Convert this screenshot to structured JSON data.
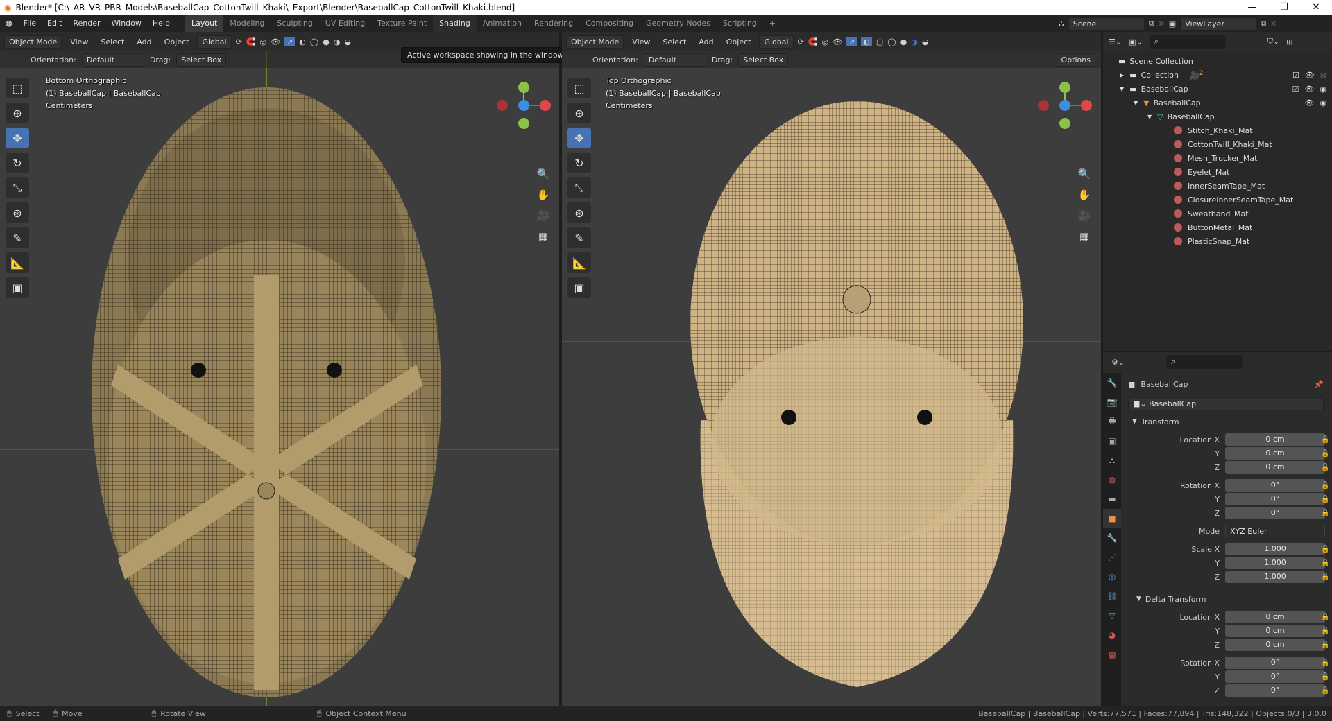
{
  "title": "Blender* [C:\\_AR_VR_PBR_Models\\BaseballCap_CottonTwill_Khaki\\_Export\\Blender\\BaseballCap_CottonTwill_Khaki.blend]",
  "menu": [
    "File",
    "Edit",
    "Render",
    "Window",
    "Help"
  ],
  "workspaces": [
    "Layout",
    "Modeling",
    "Sculpting",
    "UV Editing",
    "Texture Paint",
    "Shading",
    "Animation",
    "Rendering",
    "Compositing",
    "Geometry Nodes",
    "Scripting"
  ],
  "scene": "Scene",
  "view_layer": "ViewLayer",
  "tooltip": "Active workspace showing in the window.",
  "viewport_header": {
    "mode": "Object Mode",
    "view": "View",
    "select": "Select",
    "add": "Add",
    "object": "Object",
    "transform": "Global",
    "orientation_label": "Orientation:",
    "orientation": "Default",
    "drag_label": "Drag:",
    "drag": "Select Box",
    "options": "Options"
  },
  "left_view": {
    "name": "Bottom Orthographic",
    "object": "(1) BaseballCap | BaseballCap",
    "units": "Centimeters"
  },
  "right_view": {
    "name": "Top Orthographic",
    "object": "(1) BaseballCap | BaseballCap",
    "units": "Centimeters"
  },
  "outliner": {
    "root": "Scene Collection",
    "collection": "Collection",
    "collection_badge": "2",
    "cap_collection": "BaseballCap",
    "object": "BaseballCap",
    "mesh": "BaseballCap",
    "materials": [
      "Stitch_Khaki_Mat",
      "CottonTwill_Khaki_Mat",
      "Mesh_Trucker_Mat",
      "Eyelet_Mat",
      "InnerSeamTape_Mat",
      "ClosureInnerSeamTape_Mat",
      "Sweatband_Mat",
      "ButtonMetal_Mat",
      "PlasticSnap_Mat"
    ]
  },
  "properties": {
    "object_name": "BaseballCap",
    "datablock": "BaseballCap",
    "transform": "Transform",
    "location": {
      "label": "Location X",
      "x": "0 cm",
      "y": "0 cm",
      "z": "0 cm"
    },
    "rotation": {
      "label": "Rotation X",
      "x": "0°",
      "y": "0°",
      "z": "0°"
    },
    "mode_label": "Mode",
    "mode": "XYZ Euler",
    "scale": {
      "label": "Scale X",
      "x": "1.000",
      "y": "1.000",
      "z": "1.000"
    },
    "delta": "Delta Transform",
    "delta_location": {
      "label": "Location X",
      "x": "0 cm",
      "y": "0 cm",
      "z": "0 cm"
    },
    "delta_rotation": {
      "label": "Rotation X",
      "x": "0°",
      "y": "0°",
      "z": "0°"
    },
    "Y": "Y",
    "Z": "Z"
  },
  "status": {
    "select": "Select",
    "move": "Move",
    "rotate": "Rotate View",
    "context": "Object Context Menu",
    "stats": "BaseballCap | BaseballCap | Verts:77,571 | Faces:77,894 | Tris:148,322 | Objects:0/3 | 3.0.0"
  }
}
